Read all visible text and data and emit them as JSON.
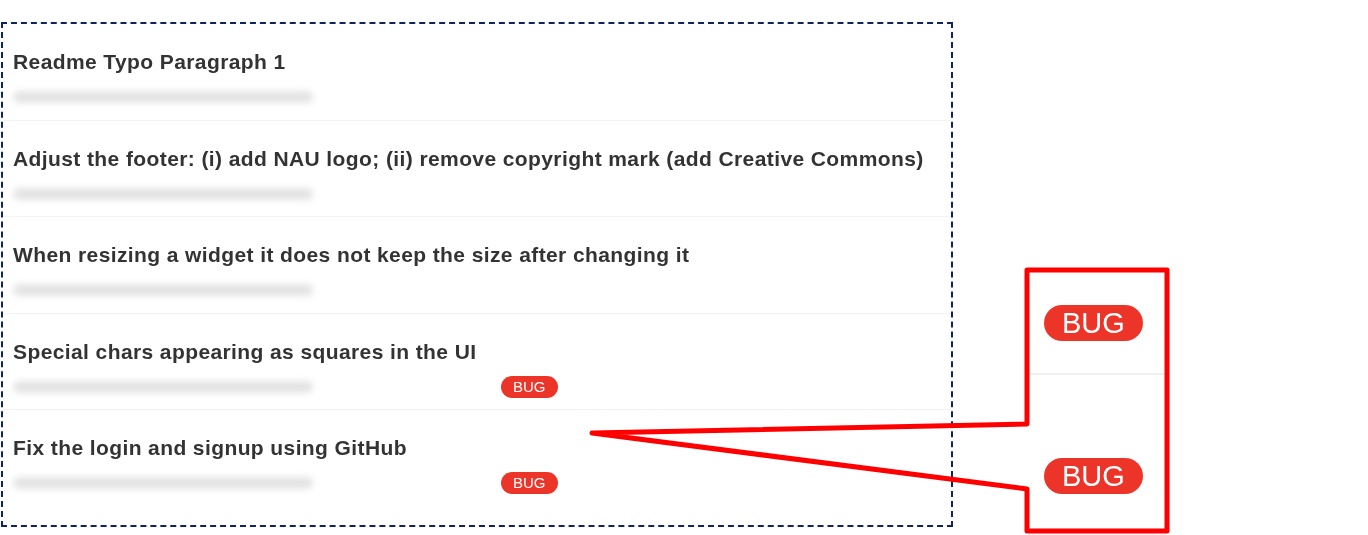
{
  "issues": [
    {
      "title": "Readme Typo Paragraph 1"
    },
    {
      "title": "Adjust the footer: (i) add NAU logo; (ii) remove copyright mark (add Creative Commons)"
    },
    {
      "title": "When resizing a widget it does not keep the size after changing it"
    },
    {
      "title": "Special chars appearing as squares in the UI",
      "labels": [
        "BUG"
      ]
    },
    {
      "title": "Fix the login and signup using GitHub",
      "labels": [
        "BUG"
      ]
    }
  ],
  "callout": {
    "labels": [
      "BUG",
      "BUG"
    ]
  }
}
